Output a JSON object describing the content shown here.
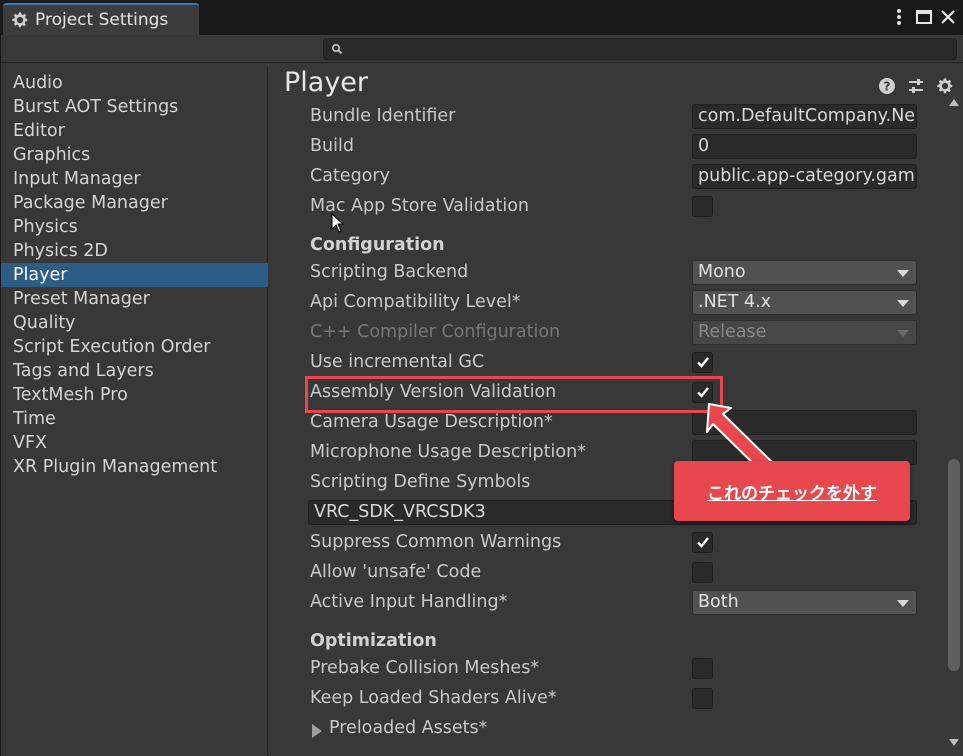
{
  "window": {
    "title": "Project Settings",
    "controls": [
      "more",
      "maximize",
      "close"
    ]
  },
  "search": {
    "placeholder": ""
  },
  "sidebar": {
    "items": [
      {
        "label": "Audio"
      },
      {
        "label": "Burst AOT Settings"
      },
      {
        "label": "Editor"
      },
      {
        "label": "Graphics"
      },
      {
        "label": "Input Manager"
      },
      {
        "label": "Package Manager"
      },
      {
        "label": "Physics"
      },
      {
        "label": "Physics 2D"
      },
      {
        "label": "Player",
        "selected": true
      },
      {
        "label": "Preset Manager"
      },
      {
        "label": "Quality"
      },
      {
        "label": "Script Execution Order"
      },
      {
        "label": "Tags and Layers"
      },
      {
        "label": "TextMesh Pro"
      },
      {
        "label": "Time"
      },
      {
        "label": "VFX"
      },
      {
        "label": "XR Plugin Management"
      }
    ]
  },
  "main": {
    "title": "Player",
    "header_icons": [
      "help-icon",
      "preset-sliders-icon",
      "gear-icon"
    ],
    "rows": {
      "bundle_identifier": {
        "label": "Bundle Identifier",
        "value": "com.DefaultCompany.Ne"
      },
      "build": {
        "label": "Build",
        "value": "0"
      },
      "category": {
        "label": "Category",
        "value": "public.app-category.gam"
      },
      "mac_app_store_validation": {
        "label": "Mac App Store Validation",
        "checked": false
      },
      "configuration_header": "Configuration",
      "scripting_backend": {
        "label": "Scripting Backend",
        "value": "Mono"
      },
      "api_compatibility": {
        "label": "Api Compatibility Level*",
        "value": ".NET 4.x"
      },
      "cpp_compiler": {
        "label": "C++ Compiler Configuration",
        "value": "Release",
        "disabled": true
      },
      "incremental_gc": {
        "label": "Use incremental GC",
        "checked": true
      },
      "assembly_version_validation": {
        "label": "Assembly Version Validation",
        "checked": true
      },
      "camera_usage": {
        "label": "Camera Usage Description*",
        "value": ""
      },
      "microphone_usage": {
        "label": "Microphone Usage Description*",
        "value": ""
      },
      "scripting_define_symbols": {
        "label": "Scripting Define Symbols",
        "value": "VRC_SDK_VRCSDK3"
      },
      "suppress_warnings": {
        "label": "Suppress Common Warnings",
        "checked": true
      },
      "allow_unsafe": {
        "label": "Allow 'unsafe' Code",
        "checked": false
      },
      "active_input": {
        "label": "Active Input Handling*",
        "value": "Both"
      },
      "optimization_header": "Optimization",
      "prebake_collision": {
        "label": "Prebake Collision Meshes*",
        "checked": false
      },
      "keep_shaders": {
        "label": "Keep Loaded Shaders Alive*",
        "checked": false
      },
      "preloaded_assets": {
        "label": "Preloaded Assets*"
      }
    }
  },
  "annotation": {
    "callout_text": "これのチェックを外す",
    "color": "#e8484d"
  },
  "colors": {
    "accent_selected": "#2c5d87",
    "tab_accent": "#3a79bb",
    "background": "#383838"
  }
}
